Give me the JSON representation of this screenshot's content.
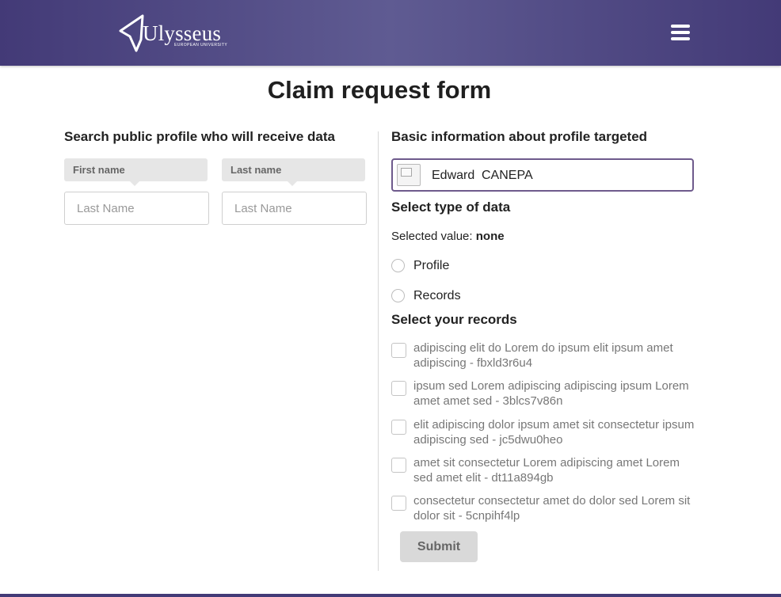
{
  "header": {
    "logo_text": "Ulysseus",
    "logo_subtext": "EUROPEAN UNIVERSITY",
    "menu_icon": "hamburger-menu-icon",
    "bar_color": "#4a4280"
  },
  "page": {
    "title": "Claim request form"
  },
  "search": {
    "heading": "Search public profile who will receive data",
    "first_name_label": "First name",
    "last_name_label": "Last name",
    "first_name_placeholder": "Last Name",
    "last_name_placeholder": "Last Name"
  },
  "profile": {
    "heading": "Basic information about profile targeted",
    "first_name": "Edward",
    "last_name": "CANEPA",
    "border_color": "#6e5a8c"
  },
  "data_type": {
    "heading": "Select type of data",
    "selected_prefix": "Selected value:",
    "selected_value": "none",
    "options": [
      "Profile",
      "Records"
    ]
  },
  "records": {
    "heading": "Select your records",
    "items": [
      "adipiscing elit do Lorem do ipsum elit ipsum amet adipiscing - fbxld3r6u4",
      "ipsum sed Lorem adipiscing adipiscing ipsum Lorem amet amet sed - 3blcs7v86n",
      "elit adipiscing dolor ipsum amet sit consectetur ipsum adipiscing sed - jc5dwu0heo",
      "amet sit consectetur Lorem adipiscing amet Lorem sed amet elit - dt11a894gb",
      "consectetur consectetur amet do dolor sed Lorem sit dolor sit - 5cnpihf4lp"
    ]
  },
  "actions": {
    "submit_label": "Submit"
  }
}
